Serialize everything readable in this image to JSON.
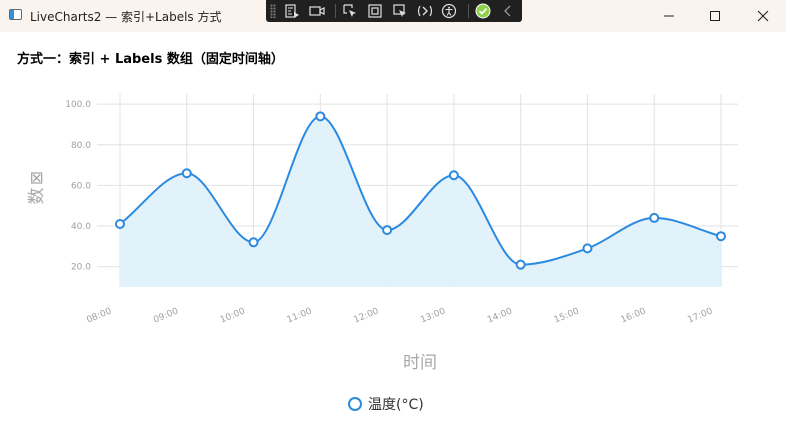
{
  "window": {
    "title": "LiveCharts2 — 索引+Labels 方式"
  },
  "heading": "方式一：索引 + Labels 数组（固定时间轴）",
  "debug_toolbar": {
    "icons": [
      "grip-icon",
      "live-visual-tree-icon",
      "video-icon",
      "select-element-icon",
      "display-layout-adorners-icon",
      "track-focus-icon",
      "hot-reload-icon",
      "accessibility-icon",
      "checkmark-icon",
      "collapse-chevron-icon"
    ]
  },
  "colors": {
    "series": "#2b8ae0",
    "fill": "#dff1fa",
    "grid": "#e2e2e2",
    "titlebar": "#fbf3ee"
  },
  "chart_data": {
    "type": "area",
    "categories": [
      "08:00",
      "09:00",
      "10:00",
      "11:00",
      "12:00",
      "13:00",
      "14:00",
      "15:00",
      "16:00",
      "17:00"
    ],
    "series": [
      {
        "name": "温度(°C)",
        "values": [
          41,
          66,
          32,
          94,
          38,
          65,
          21,
          29,
          44,
          35
        ]
      }
    ],
    "yticks": [
      "20.0",
      "40.0",
      "60.0",
      "80.0",
      "100.0"
    ],
    "ylim": [
      10,
      105
    ],
    "xlabel": "时间",
    "ylabel": "数",
    "grid": true,
    "legend_position": "bottom"
  }
}
